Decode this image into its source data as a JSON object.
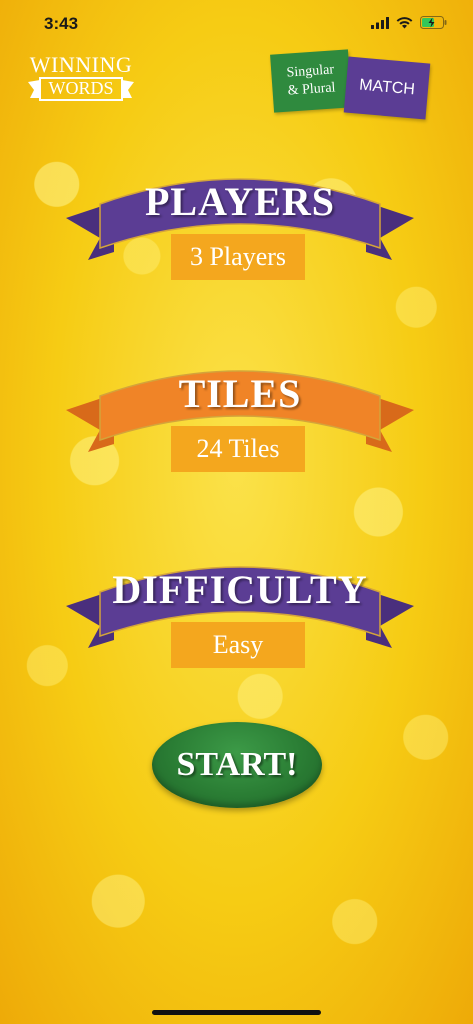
{
  "status_bar": {
    "time": "3:43",
    "icons": [
      "cellular-signal-icon",
      "wifi-icon",
      "battery-charging-icon"
    ]
  },
  "logo": {
    "line1": "WINNING",
    "line2": "WORDS"
  },
  "game_badge": {
    "left_text_line1": "Singular",
    "left_text_line2": "& Plural",
    "right_text": "MATCH"
  },
  "settings": {
    "players": {
      "title": "PLAYERS",
      "value": "3 Players"
    },
    "tiles": {
      "title": "TILES",
      "value": "24 Tiles"
    },
    "difficulty": {
      "title": "DIFFICULTY",
      "value": "Easy"
    }
  },
  "start_label": "START!",
  "colors": {
    "background": "#f7cf18",
    "purple_ribbon": "#5b3d94",
    "orange_ribbon": "#f08427",
    "value_box": "#f4a71e",
    "start_green": "#2a7d34",
    "badge_green": "#2f8a3e"
  }
}
